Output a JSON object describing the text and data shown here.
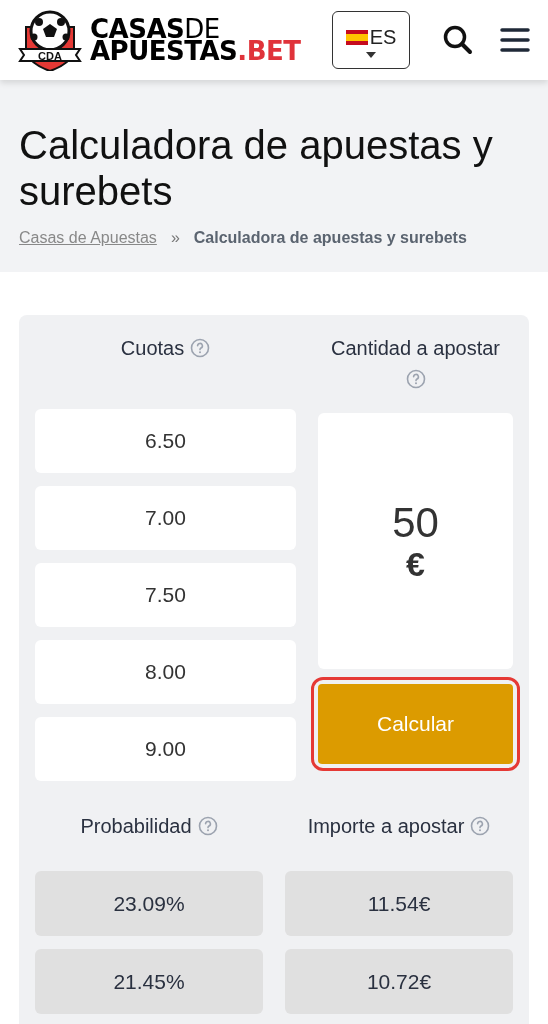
{
  "header": {
    "logo": {
      "badge": "CDA",
      "line1_bold": "CASAS",
      "line1_light": "DE",
      "line2_bold": "APUESTAS",
      "line2_accent": ".BET"
    },
    "language": {
      "code": "ES"
    }
  },
  "page_title": "Calculadora de apuestas y surebets",
  "breadcrumbs": [
    {
      "label": "Casas de Apuestas",
      "link": true
    },
    {
      "label": "Calculadora de apuestas y surebets",
      "link": false
    }
  ],
  "breadcrumb_separator": "»",
  "calculator": {
    "odds_label": "Cuotas",
    "amount_label": "Cantidad a apostar",
    "odds": [
      "6.50",
      "7.00",
      "7.50",
      "8.00",
      "9.00"
    ],
    "amount": "50",
    "currency": "€",
    "calculate_button": {
      "label": "Calcular",
      "focused": true
    },
    "probability_label": "Probabilidad",
    "stake_label": "Importe a apostar",
    "results": [
      {
        "probability": "23.09%",
        "stake": "11.54€"
      },
      {
        "probability": "21.45%",
        "stake": "10.72€"
      }
    ]
  }
}
